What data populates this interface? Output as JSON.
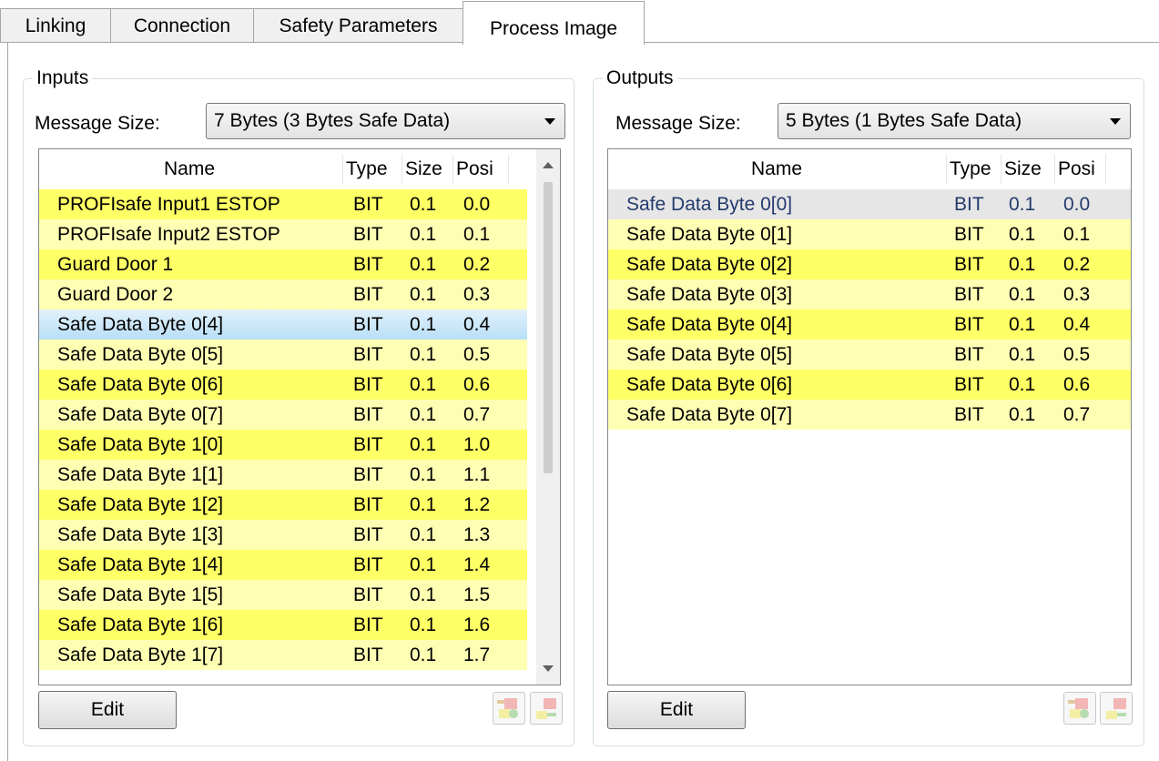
{
  "tabs": [
    "Linking",
    "Connection",
    "Safety Parameters",
    "Process Image"
  ],
  "active_tab": "Process Image",
  "inputs": {
    "title": "Inputs",
    "message_size_label": "Message Size:",
    "message_size_value": "7 Bytes (3 Bytes Safe Data)",
    "columns": [
      "Name",
      "Type",
      "Size",
      "Posi"
    ],
    "rows": [
      {
        "name": "PROFIsafe Input1 ESTOP",
        "type": "BIT",
        "size": "0.1",
        "pos": "0.0"
      },
      {
        "name": "PROFIsafe Input2 ESTOP",
        "type": "BIT",
        "size": "0.1",
        "pos": "0.1"
      },
      {
        "name": "Guard Door 1",
        "type": "BIT",
        "size": "0.1",
        "pos": "0.2"
      },
      {
        "name": "Guard Door 2",
        "type": "BIT",
        "size": "0.1",
        "pos": "0.3"
      },
      {
        "name": "Safe Data Byte 0[4]",
        "type": "BIT",
        "size": "0.1",
        "pos": "0.4"
      },
      {
        "name": "Safe Data Byte 0[5]",
        "type": "BIT",
        "size": "0.1",
        "pos": "0.5"
      },
      {
        "name": "Safe Data Byte 0[6]",
        "type": "BIT",
        "size": "0.1",
        "pos": "0.6"
      },
      {
        "name": "Safe Data Byte 0[7]",
        "type": "BIT",
        "size": "0.1",
        "pos": "0.7"
      },
      {
        "name": "Safe Data Byte 1[0]",
        "type": "BIT",
        "size": "0.1",
        "pos": "1.0"
      },
      {
        "name": "Safe Data Byte 1[1]",
        "type": "BIT",
        "size": "0.1",
        "pos": "1.1"
      },
      {
        "name": "Safe Data Byte 1[2]",
        "type": "BIT",
        "size": "0.1",
        "pos": "1.2"
      },
      {
        "name": "Safe Data Byte 1[3]",
        "type": "BIT",
        "size": "0.1",
        "pos": "1.3"
      },
      {
        "name": "Safe Data Byte 1[4]",
        "type": "BIT",
        "size": "0.1",
        "pos": "1.4"
      },
      {
        "name": "Safe Data Byte 1[5]",
        "type": "BIT",
        "size": "0.1",
        "pos": "1.5"
      },
      {
        "name": "Safe Data Byte 1[6]",
        "type": "BIT",
        "size": "0.1",
        "pos": "1.6"
      },
      {
        "name": "Safe Data Byte 1[7]",
        "type": "BIT",
        "size": "0.1",
        "pos": "1.7"
      }
    ],
    "selected_row": 4,
    "edit_label": "Edit",
    "icons": [
      "add-mapping-icon",
      "remove-mapping-icon"
    ]
  },
  "outputs": {
    "title": "Outputs",
    "message_size_label": "Message Size:",
    "message_size_value": "5 Bytes (1 Bytes Safe Data)",
    "columns": [
      "Name",
      "Type",
      "Size",
      "Posi"
    ],
    "rows": [
      {
        "name": "Safe Data Byte 0[0]",
        "type": "BIT",
        "size": "0.1",
        "pos": "0.0"
      },
      {
        "name": "Safe Data Byte 0[1]",
        "type": "BIT",
        "size": "0.1",
        "pos": "0.1"
      },
      {
        "name": "Safe Data Byte 0[2]",
        "type": "BIT",
        "size": "0.1",
        "pos": "0.2"
      },
      {
        "name": "Safe Data Byte 0[3]",
        "type": "BIT",
        "size": "0.1",
        "pos": "0.3"
      },
      {
        "name": "Safe Data Byte 0[4]",
        "type": "BIT",
        "size": "0.1",
        "pos": "0.4"
      },
      {
        "name": "Safe Data Byte 0[5]",
        "type": "BIT",
        "size": "0.1",
        "pos": "0.5"
      },
      {
        "name": "Safe Data Byte 0[6]",
        "type": "BIT",
        "size": "0.1",
        "pos": "0.6"
      },
      {
        "name": "Safe Data Byte 0[7]",
        "type": "BIT",
        "size": "0.1",
        "pos": "0.7"
      }
    ],
    "selected_row": 0,
    "edit_label": "Edit",
    "icons": [
      "add-mapping-icon",
      "remove-mapping-icon"
    ]
  },
  "colors": {
    "row_dark": "#ffff66",
    "row_light": "#ffffb4",
    "selected": "#b8dff7",
    "inactive_selected": "#e6e6e6"
  }
}
